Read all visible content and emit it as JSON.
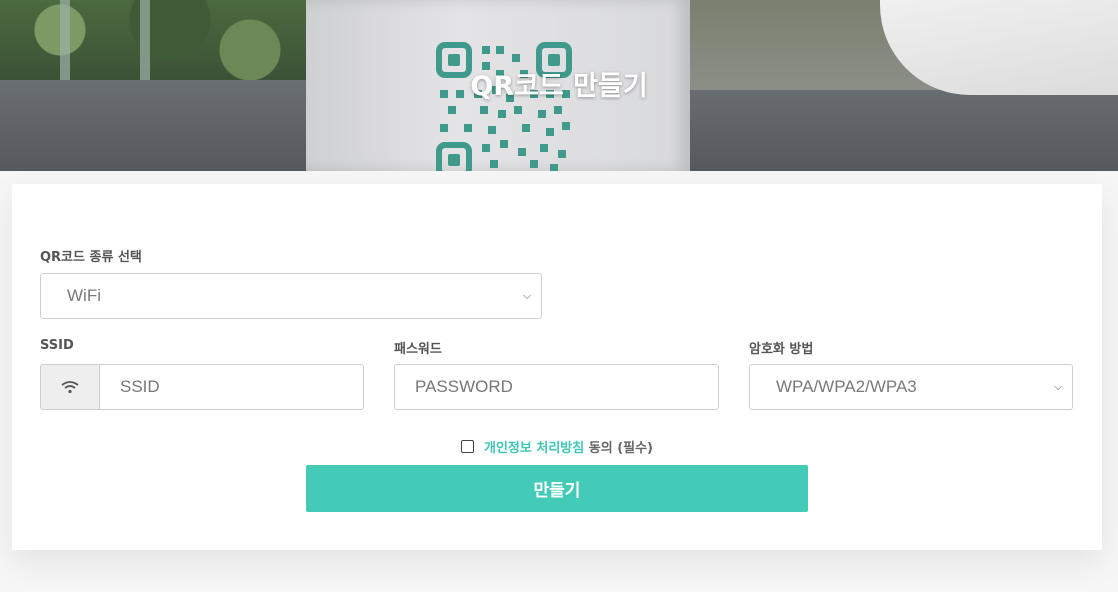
{
  "header": {
    "title": "QR코드 만들기"
  },
  "form": {
    "qr_type_label": "QR코드 종류 선택",
    "qr_type_value": "WiFi",
    "ssid_label": "SSID",
    "ssid_placeholder": "SSID",
    "ssid_addon_icon": "wifi-icon",
    "password_label": "패스워드",
    "password_placeholder": "PASSWORD",
    "encryption_label": "암호화 방법",
    "encryption_value": "WPA/WPA2/WPA3",
    "consent_link": "개인정보 처리방침",
    "consent_suffix": " 동의 (필수)",
    "submit_label": "만들기"
  },
  "colors": {
    "accent": "#44cbb8",
    "link": "#3fc7b5"
  }
}
